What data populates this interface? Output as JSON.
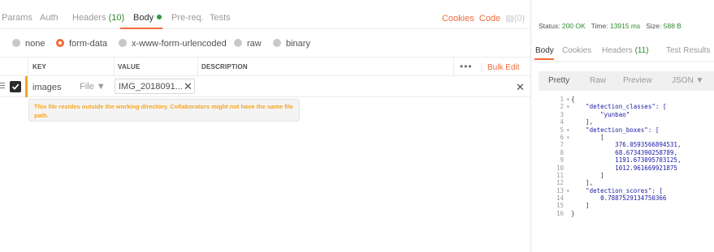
{
  "request": {
    "tabs": [
      {
        "label": "Params",
        "count": "",
        "dot": false
      },
      {
        "label": "Auth",
        "count": "",
        "dot": false
      },
      {
        "label": "Headers",
        "count": "(10)",
        "dot": false
      },
      {
        "label": "Body",
        "count": "",
        "dot": true
      },
      {
        "label": "Pre-req.",
        "count": "",
        "dot": false
      },
      {
        "label": "Tests",
        "count": "",
        "dot": false
      }
    ],
    "cookies_label": "Cookies",
    "code_label": "Code",
    "comments_count": "(0)"
  },
  "body_types": [
    {
      "label": "none",
      "selected": false
    },
    {
      "label": "form-data",
      "selected": true
    },
    {
      "label": "x-www-form-urlencoded",
      "selected": false
    },
    {
      "label": "raw",
      "selected": false
    },
    {
      "label": "binary",
      "selected": false
    }
  ],
  "table": {
    "headers": {
      "key": "KEY",
      "value": "VALUE",
      "description": "DESCRIPTION"
    },
    "more_label": "•••",
    "bulk_edit_label": "Bulk Edit",
    "row": {
      "key": "images",
      "type": "File ▼",
      "file_name": "IMG_2018091...",
      "remove_glyph": "✕",
      "row_remove_glyph": "✕"
    },
    "tooltip": "This file resides outside the working directory. Collaborators might not have the same file path."
  },
  "response": {
    "status_label": "Status:",
    "status_value": "200 OK",
    "time_label": "Time:",
    "time_value": "13915 ms",
    "size_label": "Size:",
    "size_value": "588 B",
    "tabs": [
      {
        "label": "Body",
        "count": ""
      },
      {
        "label": "Cookies",
        "count": ""
      },
      {
        "label": "Headers",
        "count": "(11)"
      },
      {
        "label": "Test Results",
        "count": ""
      }
    ],
    "view_modes": [
      "Pretty",
      "Raw",
      "Preview"
    ],
    "format": "JSON ▼",
    "code_lines": [
      {
        "n": "1",
        "fold": "▾",
        "text": "{"
      },
      {
        "n": "2",
        "fold": "▾",
        "text": "    \"detection_classes\": ["
      },
      {
        "n": "3",
        "fold": "",
        "text": "        \"yunbao\""
      },
      {
        "n": "4",
        "fold": "",
        "text": "    ],"
      },
      {
        "n": "5",
        "fold": "▾",
        "text": "    \"detection_boxes\": ["
      },
      {
        "n": "6",
        "fold": "▾",
        "text": "        ["
      },
      {
        "n": "7",
        "fold": "",
        "text": "            376.0593566894531,"
      },
      {
        "n": "8",
        "fold": "",
        "text": "            68.6734390258789,"
      },
      {
        "n": "9",
        "fold": "",
        "text": "            1191.673095703125,"
      },
      {
        "n": "10",
        "fold": "",
        "text": "            1012.961669921875"
      },
      {
        "n": "11",
        "fold": "",
        "text": "        ]"
      },
      {
        "n": "12",
        "fold": "",
        "text": "    ],"
      },
      {
        "n": "13",
        "fold": "▾",
        "text": "    \"detection_scores\": ["
      },
      {
        "n": "14",
        "fold": "",
        "text": "        0.7887529134750366"
      },
      {
        "n": "15",
        "fold": "",
        "text": "    ]"
      },
      {
        "n": "16",
        "fold": "",
        "text": "}"
      }
    ]
  },
  "colors": {
    "accent": "#f26b3a",
    "success": "#2e8b2e",
    "warning": "#f5a623"
  }
}
